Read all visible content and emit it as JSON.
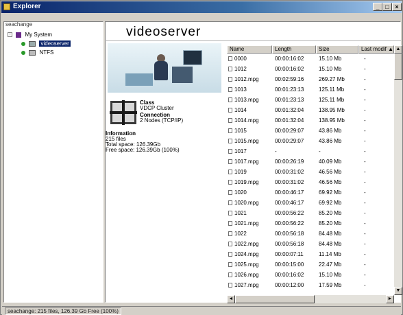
{
  "window": {
    "title": "Explorer",
    "controls": [
      "_",
      "□",
      "×"
    ]
  },
  "tree": {
    "header": "seachange",
    "items": [
      {
        "label": "My System",
        "expander": "-",
        "icon": "server-group-icon"
      },
      {
        "label": "videoserver",
        "expander": "",
        "icon": "video-drive-icon",
        "selected": true
      },
      {
        "label": "NTFS",
        "expander": "",
        "icon": "disk-drive-icon"
      }
    ]
  },
  "main": {
    "title": "videoserver",
    "class_label": "Class",
    "class_value": "VDCP Cluster",
    "connection_label": "Connection",
    "connection_value": "2 Nodes (TCP/IP)",
    "information_label": "Information",
    "info_lines": [
      "215 files",
      "Total space: 126.39Gb",
      "Free space: 126.39Gb (100%)"
    ]
  },
  "file_list": {
    "columns": [
      "Name",
      "Length",
      "Size",
      "Last modif"
    ],
    "sort_indicator": "▲",
    "rows": [
      {
        "name": "0000",
        "length": "00:00:16:02",
        "size": "15.10 Mb",
        "modified": "-"
      },
      {
        "name": "1012",
        "length": "00:00:16:02",
        "size": "15.10 Mb",
        "modified": "-"
      },
      {
        "name": "1012.mpg",
        "length": "00:02:59:16",
        "size": "269.27 Mb",
        "modified": "-"
      },
      {
        "name": "1013",
        "length": "00:01:23:13",
        "size": "125.11 Mb",
        "modified": "-"
      },
      {
        "name": "1013.mpg",
        "length": "00:01:23:13",
        "size": "125.11 Mb",
        "modified": "-"
      },
      {
        "name": "1014",
        "length": "00:01:32:04",
        "size": "138.95 Mb",
        "modified": "-"
      },
      {
        "name": "1014.mpg",
        "length": "00:01:32:04",
        "size": "138.95 Mb",
        "modified": "-"
      },
      {
        "name": "1015",
        "length": "00:00:29:07",
        "size": "43.86 Mb",
        "modified": "-"
      },
      {
        "name": "1015.mpg",
        "length": "00:00:29:07",
        "size": "43.86 Mb",
        "modified": "-"
      },
      {
        "name": "1017",
        "length": "-",
        "size": "-",
        "modified": "-"
      },
      {
        "name": "1017.mpg",
        "length": "00:00:26:19",
        "size": "40.09 Mb",
        "modified": "-"
      },
      {
        "name": "1019",
        "length": "00:00:31:02",
        "size": "46.56 Mb",
        "modified": "-"
      },
      {
        "name": "1019.mpg",
        "length": "00:00:31:02",
        "size": "46.56 Mb",
        "modified": "-"
      },
      {
        "name": "1020",
        "length": "00:00:46:17",
        "size": "69.92 Mb",
        "modified": "-"
      },
      {
        "name": "1020.mpg",
        "length": "00:00:46:17",
        "size": "69.92 Mb",
        "modified": "-"
      },
      {
        "name": "1021",
        "length": "00:00:56:22",
        "size": "85.20 Mb",
        "modified": "-"
      },
      {
        "name": "1021.mpg",
        "length": "00:00:56:22",
        "size": "85.20 Mb",
        "modified": "-"
      },
      {
        "name": "1022",
        "length": "00:00:56:18",
        "size": "84.48 Mb",
        "modified": "-"
      },
      {
        "name": "1022.mpg",
        "length": "00:00:56:18",
        "size": "84.48 Mb",
        "modified": "-"
      },
      {
        "name": "1024.mpg",
        "length": "00:00:07:11",
        "size": "11.14 Mb",
        "modified": "-"
      },
      {
        "name": "1025.mpg",
        "length": "00:00:15:00",
        "size": "22.47 Mb",
        "modified": "-"
      },
      {
        "name": "1026.mpg",
        "length": "00:00:16:02",
        "size": "15.10 Mb",
        "modified": "-"
      },
      {
        "name": "1027.mpg",
        "length": "00:00:12:00",
        "size": "17.59 Mb",
        "modified": "-"
      }
    ]
  },
  "status": {
    "text": "seachange: 215 files, 126.39 Gb Free (100%)"
  },
  "scroll": {
    "up": "▲",
    "down": "▼",
    "left": "◄",
    "right": "►"
  }
}
